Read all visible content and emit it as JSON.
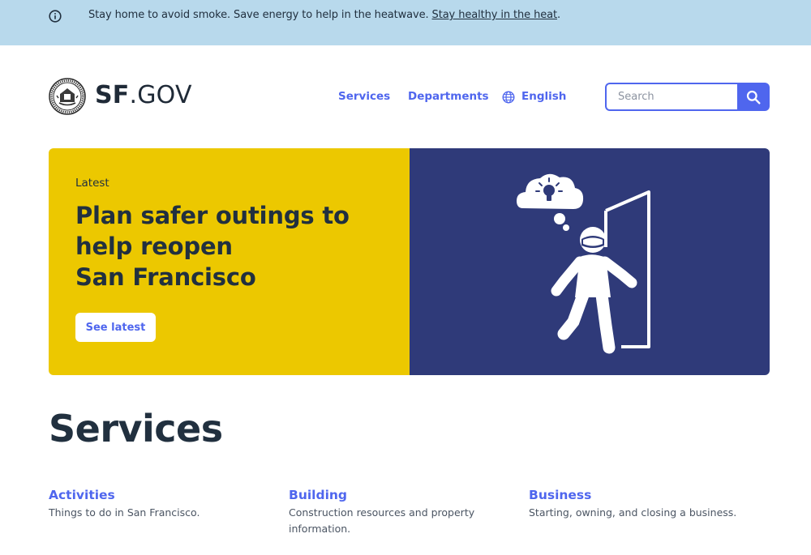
{
  "alert": {
    "icon": "info-circle-icon",
    "message": "Stay home to avoid smoke. Save energy to help in the heatwave. ",
    "link_text": "Stay healthy in the heat",
    "trailing": "."
  },
  "header": {
    "logo_icon": "city-seal-icon",
    "brand_bold": "SF",
    "brand_rest": ".GOV",
    "nav": {
      "services": "Services",
      "departments": "Departments",
      "language": "English",
      "language_icon": "globe-icon"
    },
    "search": {
      "placeholder": "Search",
      "button_icon": "search-icon"
    }
  },
  "hero": {
    "eyebrow": "Latest",
    "title": "Plan safer outings to\nhelp reopen\nSan Francisco",
    "button_label": "See latest",
    "illustration_icon": "person-leaving-door-icon"
  },
  "services": {
    "heading": "Services",
    "items": [
      {
        "title": "Activities",
        "description": "Things to do in San Francisco."
      },
      {
        "title": "Building",
        "description": "Construction resources and property information."
      },
      {
        "title": "Business",
        "description": "Starting, owning, and closing a business."
      }
    ]
  },
  "colors": {
    "alert_bg": "#b8d9ec",
    "accent": "#4f66ee",
    "hero_yellow": "#ecc800",
    "hero_navy": "#2f3a79",
    "text_dark": "#21303f"
  }
}
